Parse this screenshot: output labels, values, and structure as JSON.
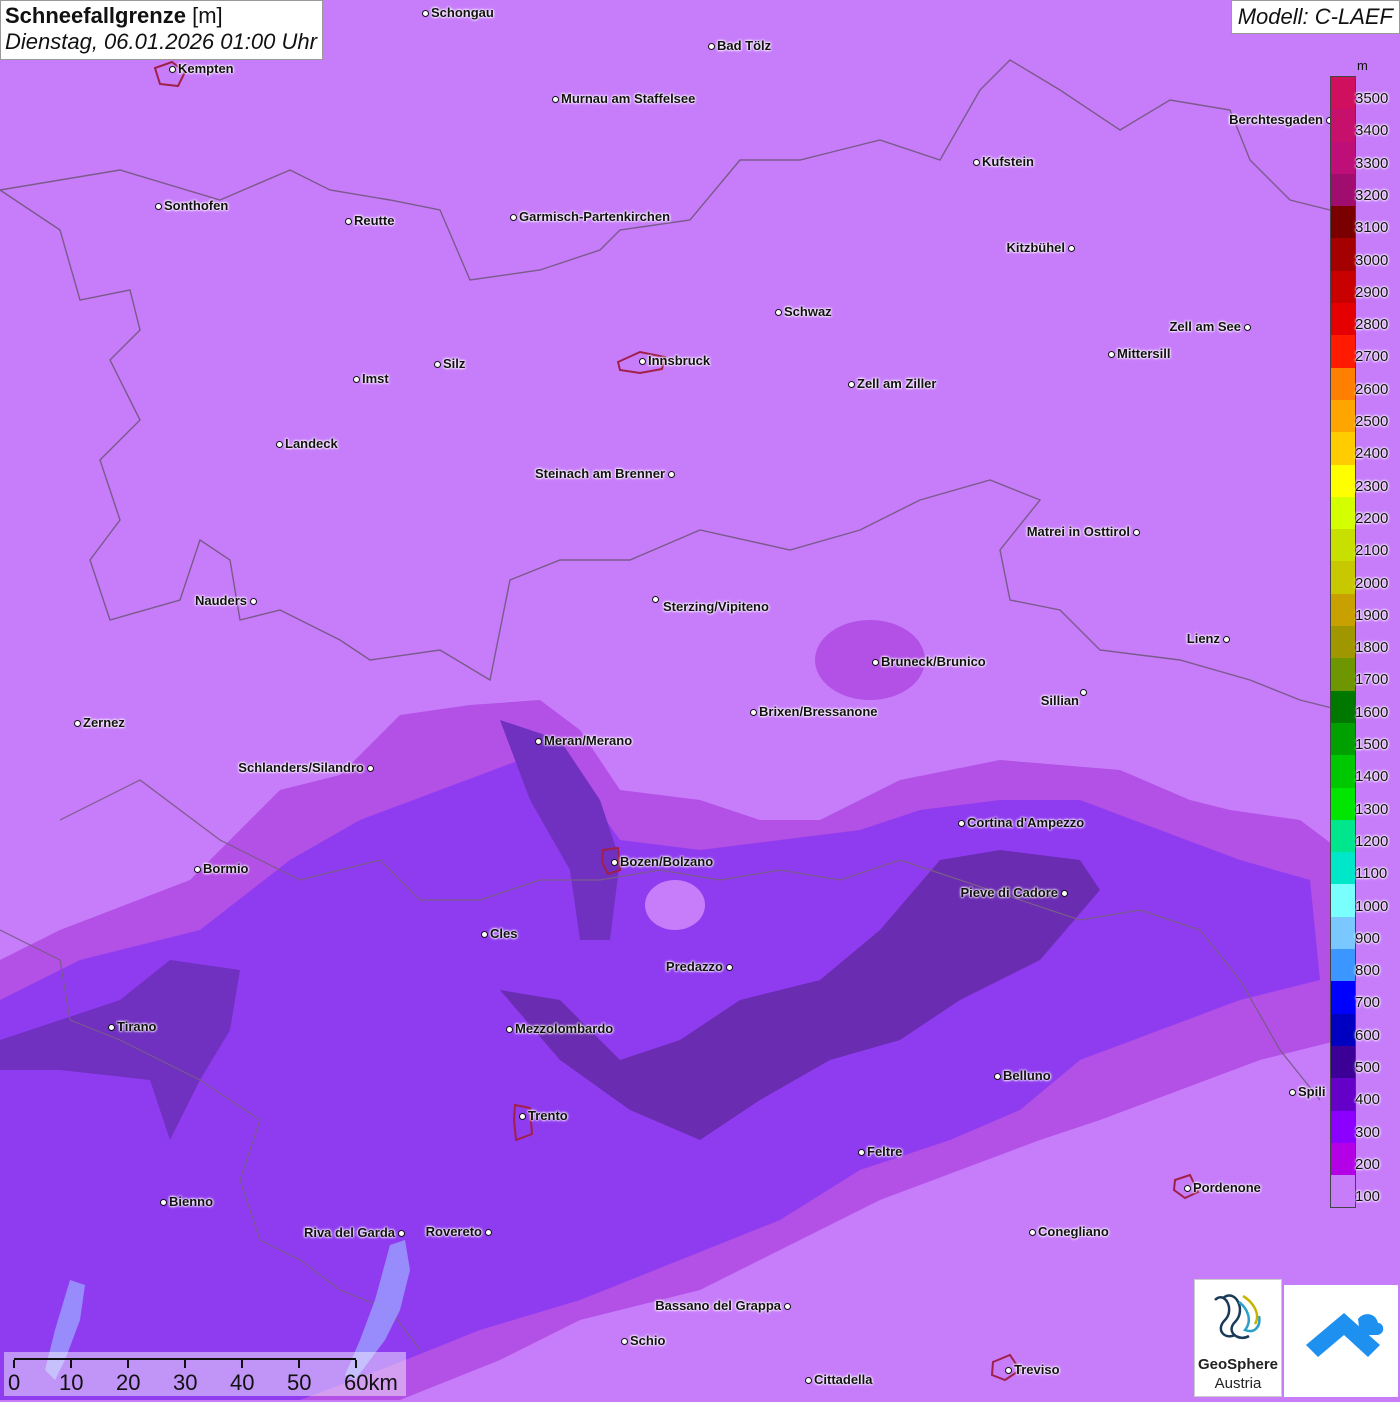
{
  "header": {
    "title": "Schneefallgrenze",
    "unit": "[m]",
    "datetime": "Dienstag, 06.01.2026 01:00 Uhr",
    "model": "Modell: C-LAEF"
  },
  "legend": {
    "unit": "m",
    "levels": [
      {
        "value": "3500",
        "color": "#d0105f"
      },
      {
        "value": "3400",
        "color": "#c70f6c"
      },
      {
        "value": "3300",
        "color": "#be0e77"
      },
      {
        "value": "3200",
        "color": "#a00d6e"
      },
      {
        "value": "3100",
        "color": "#7a0000"
      },
      {
        "value": "3000",
        "color": "#a50000"
      },
      {
        "value": "2900",
        "color": "#c80000"
      },
      {
        "value": "2800",
        "color": "#e40000"
      },
      {
        "value": "2700",
        "color": "#ff1a00"
      },
      {
        "value": "2600",
        "color": "#ff7f00"
      },
      {
        "value": "2500",
        "color": "#ffa500"
      },
      {
        "value": "2400",
        "color": "#ffcc00"
      },
      {
        "value": "2300",
        "color": "#ffff00"
      },
      {
        "value": "2200",
        "color": "#d4ff00"
      },
      {
        "value": "2100",
        "color": "#c8e000"
      },
      {
        "value": "2000",
        "color": "#c8c800"
      },
      {
        "value": "1900",
        "color": "#c8a000"
      },
      {
        "value": "1800",
        "color": "#a09600"
      },
      {
        "value": "1700",
        "color": "#6e9600"
      },
      {
        "value": "1600",
        "color": "#007800"
      },
      {
        "value": "1500",
        "color": "#00a000"
      },
      {
        "value": "1400",
        "color": "#00c800"
      },
      {
        "value": "1300",
        "color": "#00e600"
      },
      {
        "value": "1200",
        "color": "#00e68c"
      },
      {
        "value": "1100",
        "color": "#00e6c8"
      },
      {
        "value": "1000",
        "color": "#7affff"
      },
      {
        "value": "900",
        "color": "#7ac8ff"
      },
      {
        "value": "800",
        "color": "#3c96ff"
      },
      {
        "value": "700",
        "color": "#0000ff"
      },
      {
        "value": "600",
        "color": "#0000c0"
      },
      {
        "value": "500",
        "color": "#3c0096"
      },
      {
        "value": "400",
        "color": "#6400c8"
      },
      {
        "value": "300",
        "color": "#8c00ff"
      },
      {
        "value": "200",
        "color": "#b400e6"
      },
      {
        "value": "100",
        "color": "#c77dfa"
      }
    ]
  },
  "scale_bar": {
    "labels": [
      "0",
      "10",
      "20",
      "30",
      "40",
      "50",
      "60km"
    ]
  },
  "cities": [
    "Schongau",
    "Bad Tölz",
    "Kempten",
    "Murnau am Staffelsee",
    "Berchtesgaden",
    "Kufstein",
    "Sonthofen",
    "Reutte",
    "Garmisch-Partenkirchen",
    "Kitzbühel",
    "Schwaz",
    "Zell am See",
    "Mittersill",
    "Innsbruck",
    "Zell am Ziller",
    "Imst",
    "Silz",
    "Landeck",
    "Steinach am Brenner",
    "Matrei in Osttirol",
    "Nauders",
    "Sterzing/Vipiteno",
    "Lienz",
    "Bruneck/Brunico",
    "Sillian",
    "Zernez",
    "Brixen/Bressanone",
    "Meran/Merano",
    "Schlanders/Silandro",
    "Cortina d'Ampezzo",
    "Bozen/Bolzano",
    "Bormio",
    "Pieve di Cadore",
    "Cles",
    "Predazzo",
    "Tirano",
    "Mezzolombardo",
    "Belluno",
    "Spili",
    "Trento",
    "Feltre",
    "Pordenone",
    "Bienno",
    "Riva del Garda",
    "Rovereto",
    "Conegliano",
    "Bassano del Grappa",
    "Schio",
    "Treviso",
    "Cittadella"
  ],
  "logos": {
    "geosphere_name": "GeoSphere",
    "geosphere_sub": "Austria"
  },
  "icons": {
    "geosphere": "geosphere-logo-icon",
    "app": "weather-app-logo-icon"
  }
}
